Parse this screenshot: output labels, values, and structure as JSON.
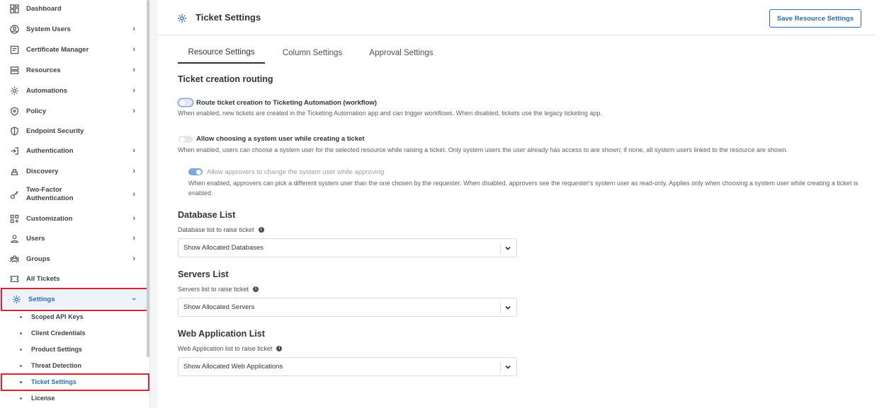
{
  "sidebar": {
    "items": [
      {
        "label": "Dashboard",
        "icon": "dashboard-icon",
        "chevron": false
      },
      {
        "label": "System Users",
        "icon": "system-users-icon",
        "chevron": true
      },
      {
        "label": "Certificate Manager",
        "icon": "certificate-icon",
        "chevron": true
      },
      {
        "label": "Resources",
        "icon": "resources-icon",
        "chevron": true
      },
      {
        "label": "Automations",
        "icon": "automations-icon",
        "chevron": true
      },
      {
        "label": "Policy",
        "icon": "policy-icon",
        "chevron": true
      },
      {
        "label": "Endpoint Security",
        "icon": "shield-icon",
        "chevron": false
      },
      {
        "label": "Authentication",
        "icon": "login-icon",
        "chevron": true
      },
      {
        "label": "Discovery",
        "icon": "discovery-icon",
        "chevron": true
      },
      {
        "label": "Two-Factor Authentication",
        "icon": "key-icon",
        "chevron": true
      },
      {
        "label": "Customization",
        "icon": "customization-icon",
        "chevron": true
      },
      {
        "label": "Users",
        "icon": "user-icon",
        "chevron": true
      },
      {
        "label": "Groups",
        "icon": "groups-icon",
        "chevron": true
      },
      {
        "label": "All Tickets",
        "icon": "ticket-icon",
        "chevron": false
      },
      {
        "label": "Settings",
        "icon": "gear-icon",
        "chevron": true,
        "expanded": true
      }
    ],
    "sub_items": [
      {
        "label": "Scoped API Keys"
      },
      {
        "label": "Client Credentials"
      },
      {
        "label": "Product Settings"
      },
      {
        "label": "Threat Detection"
      },
      {
        "label": "Ticket Settings",
        "active": true
      },
      {
        "label": "License"
      }
    ]
  },
  "header": {
    "title": "Ticket Settings",
    "save_label": "Save Resource Settings"
  },
  "tabs": [
    {
      "label": "Resource Settings",
      "active": true
    },
    {
      "label": "Column Settings"
    },
    {
      "label": "Approval Settings"
    }
  ],
  "routing": {
    "title": "Ticket creation routing",
    "options": [
      {
        "label": "Route ticket creation to Ticketing Automation (workflow)",
        "enabled": false,
        "description": "When enabled, new tickets are created in the Ticketing Automation app and can trigger workflows. When disabled, tickets use the legacy ticketing app."
      },
      {
        "label": "Allow choosing a system user while creating a ticket",
        "enabled": false,
        "description": "When enabled, users can choose a system user for the selected resource while raising a ticket. Only system users the user already has access to are shown; if none, all system users linked to the resource are shown."
      },
      {
        "label": "Allow approvers to change the system user while approving",
        "enabled": true,
        "disabled": true,
        "description": "When enabled, approvers can pick a different system user than the one chosen by the requester. When disabled, approvers see the requester's system user as read-only. Applies only when choosing a system user while creating a ticket is enabled."
      }
    ]
  },
  "lists": [
    {
      "title": "Database List",
      "field_label": "Database list to raise ticket",
      "value": "Show Allocated Databases"
    },
    {
      "title": "Servers List",
      "field_label": "Servers list to raise ticket",
      "value": "Show Allocated Servers"
    },
    {
      "title": "Web Application List",
      "field_label": "Web Application list to raise ticket",
      "value": "Show Allocated Web Applications"
    }
  ],
  "colors": {
    "accent": "#2b6cb6",
    "highlight_box": "#d9232e"
  }
}
